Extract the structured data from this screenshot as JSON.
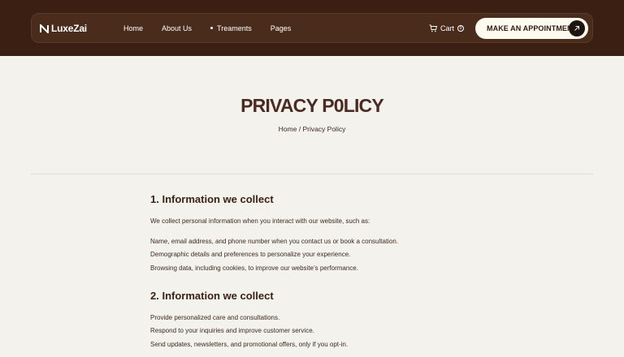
{
  "brand": {
    "name": "LuxeZai"
  },
  "nav": {
    "links": [
      {
        "label": "Home",
        "active": false
      },
      {
        "label": "About Us",
        "active": false
      },
      {
        "label": "Treaments",
        "active": true
      },
      {
        "label": "Pages",
        "active": false
      }
    ],
    "cart_label": "Cart",
    "cart_count": "0",
    "cta_label": "MAKE AN APPOINTMENT"
  },
  "hero": {
    "title": "PRIVACY P0LICY",
    "breadcrumb_home": "Home",
    "breadcrumb_sep": " / ",
    "breadcrumb_current": "Privacy Policy"
  },
  "sections": [
    {
      "heading": "1. Information we collect",
      "intro": "We collect personal information when you interact with our website, such as:",
      "items": [
        "Name, email address, and phone number when you contact us or book a consultation.",
        "Demographic details and preferences to personalize your experience.",
        "Browsing data, including cookies, to improve our website’s performance."
      ]
    },
    {
      "heading": "2. Information we collect",
      "items": [
        "Provide personalized care and consultations.",
        "Respond to your inquiries and improve customer service.",
        "Send updates, newsletters, and promotional offers, only if you opt-in."
      ]
    }
  ],
  "colors": {
    "header_bg": "#3b1f12",
    "nav_bg": "#4a2c1d",
    "page_bg": "#f4f2ec",
    "title": "#4a2a22",
    "cta_bg": "#fffaf0",
    "cta_arrow_bg": "#1e1510"
  }
}
